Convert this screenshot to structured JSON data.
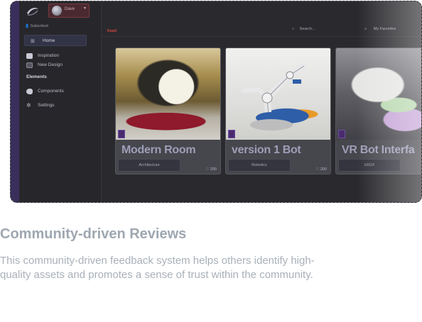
{
  "app": {
    "user_name": "Dave",
    "subscribed_label": "Subscribed",
    "feed_label": "Feed",
    "search_placeholder": "Search...",
    "favorites_label": "My Favorites"
  },
  "sidebar": {
    "home": "Home",
    "items": [
      {
        "label": "Inspiration",
        "icon": "youtube-icon"
      },
      {
        "label": "New Design",
        "icon": "image-icon"
      }
    ],
    "elements_title": "Elements",
    "elements": [
      {
        "label": "Components",
        "icon": "components-icon"
      },
      {
        "label": "Settings",
        "icon": "gear-icon"
      }
    ]
  },
  "cards": [
    {
      "title": "Modern Room",
      "tag": "Architecture",
      "likes": "200"
    },
    {
      "title": "version 1 Bot",
      "tag": "Robotics",
      "likes": "200"
    },
    {
      "title": "VR Bot Interfa",
      "tag": "UI/UX",
      "likes": ""
    }
  ],
  "caption": {
    "heading": "Community-driven Reviews",
    "description": "This community-driven feedback system helps others identify high-quality assets and promotes a sense of trust within the community."
  },
  "colors": {
    "feed_accent": "#e0463a",
    "card_title": "#9e9eb8",
    "sidebar_accent": "#3a2f5c"
  }
}
